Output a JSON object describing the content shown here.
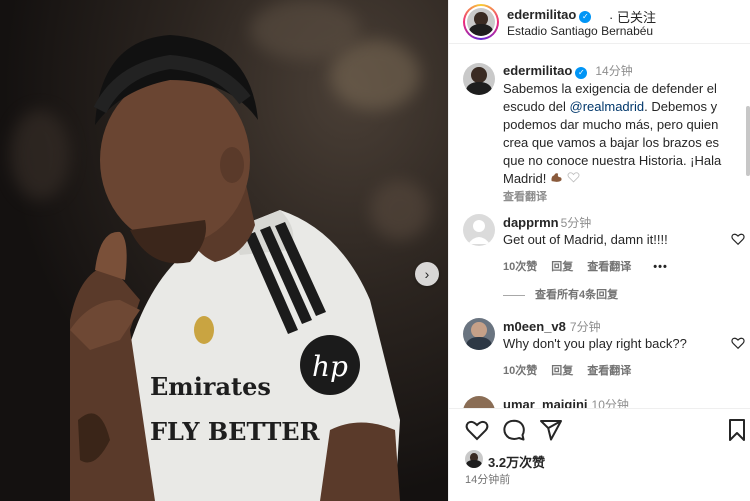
{
  "header": {
    "username": "edermilitao",
    "verified": true,
    "follow_status": "· 已关注",
    "location": "Estadio Santiago Bernabéu"
  },
  "caption": {
    "username": "edermilitao",
    "time": "14分钟",
    "text_before_mention": "Sabemos la exigencia de defender el escudo del ",
    "mention": "@realmadrid",
    "text_after_mention": ". Debemos y podemos dar mucho más, pero quien crea que vamos a bajar los brazos es que no conoce nuestra Historia. ¡Hala Madrid! ",
    "see_translation": "查看翻译"
  },
  "comments": [
    {
      "username": "dapprmn",
      "time": "5分钟",
      "text": "Get out of Madrid, damn it!!!!",
      "likes": "10次赞",
      "reply": "回复",
      "translate": "查看翻译",
      "more": "•••"
    },
    {
      "username": "m0een_v8",
      "time": "7分钟",
      "text": "Why don't you play right back??",
      "likes": "10次赞",
      "reply": "回复",
      "translate": "查看翻译"
    },
    {
      "username": "umar_maiqini",
      "time": "10分钟"
    }
  ],
  "view_replies": "查看所有4条回复",
  "actions": {
    "icons": [
      "heart-icon",
      "comment-icon",
      "share-icon",
      "bookmark-icon"
    ]
  },
  "likes_count": "3.2万次赞",
  "posted_time": "14分钟前",
  "colors": {
    "verified_blue": "#0095f6",
    "mention": "#00376b",
    "muted": "#737373"
  }
}
